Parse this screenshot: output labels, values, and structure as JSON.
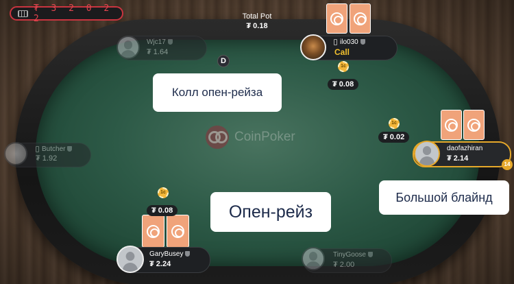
{
  "history": {
    "value": "₮ 3 2 0 2 2"
  },
  "pot": {
    "label": "Total Pot",
    "amount": "₮ 0.18"
  },
  "players": {
    "wjc17": {
      "name": "Wjc17",
      "stack": "₮ 1.64"
    },
    "ilo030": {
      "name": "ilo030",
      "action": "Call"
    },
    "butcher": {
      "name": "Butcher",
      "stack": "₮ 1.92"
    },
    "daofazhiran": {
      "name": "daofazhiran",
      "stack": "₮ 2.14",
      "badge": "14"
    },
    "garybusey": {
      "name": "GaryBusey",
      "stack": "₮ 2.24"
    },
    "tinygoose": {
      "name": "TinyGoose",
      "stack": "₮ 2.00"
    }
  },
  "dealer": {
    "label": "D"
  },
  "bets": {
    "ilo030": {
      "chip": "1c",
      "amount": "₮ 0.08"
    },
    "daofazhiran": {
      "chip": "1c",
      "amount": "₮ 0.02"
    },
    "garybusey": {
      "chip": "1c",
      "amount": "₮ 0.08"
    }
  },
  "logo": {
    "text": "CoinPoker"
  },
  "annotations": {
    "call_open_raise": "Колл опен-рейза",
    "open_raise": "Опен-рейз",
    "big_blind": "Большой блайнд"
  },
  "colors": {
    "felt": "#2d5a47",
    "card": "#f0a37a",
    "accent": "#e6a82a",
    "history_border": "#c9343f"
  }
}
